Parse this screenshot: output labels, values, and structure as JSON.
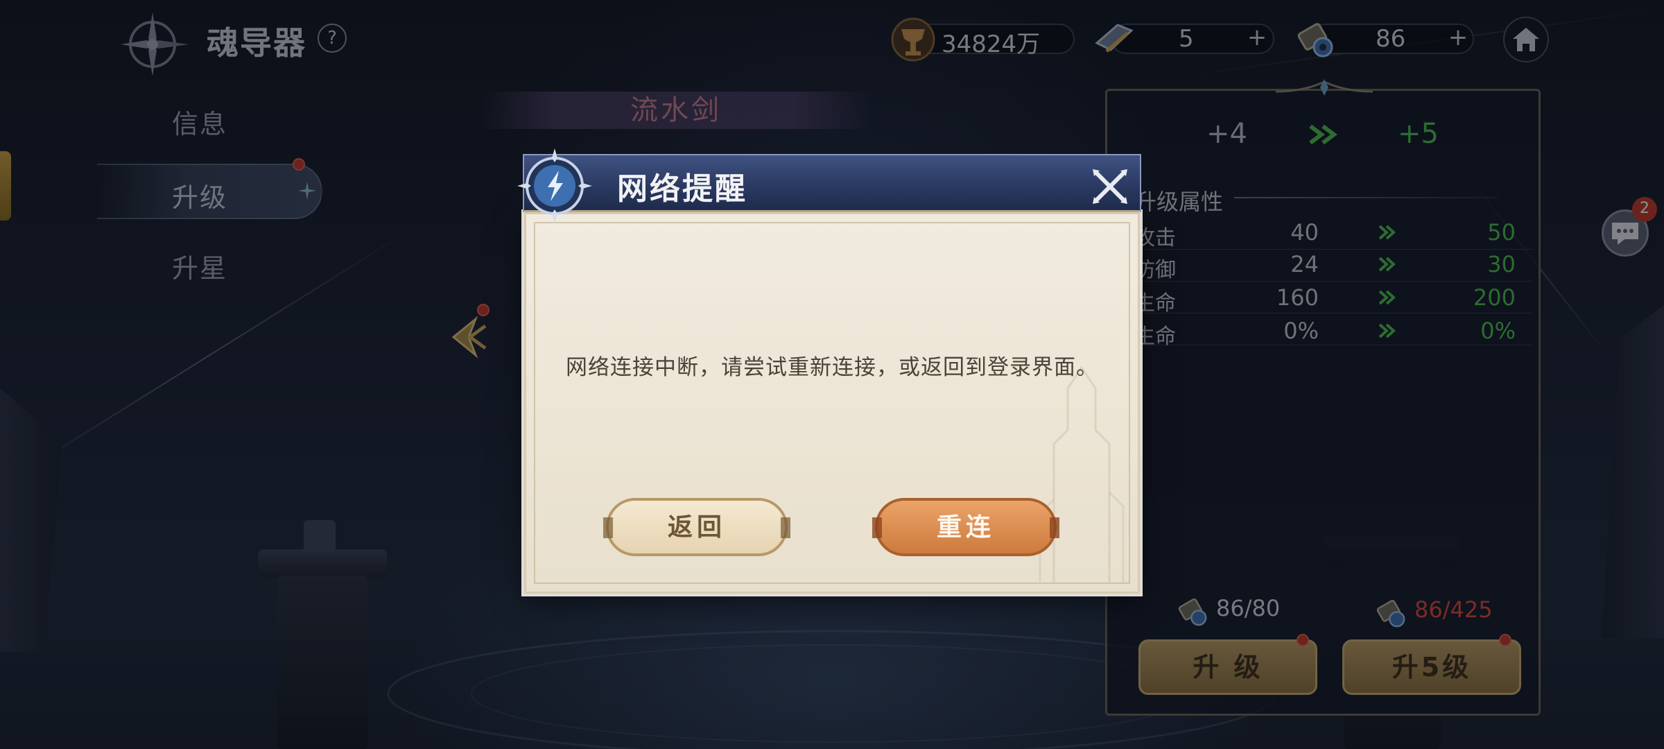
{
  "page": {
    "title": "魂导器",
    "help": "?"
  },
  "resources": {
    "gold": {
      "value": "34824万",
      "icon": "gold-trophy-icon"
    },
    "stamina": {
      "value": "5",
      "icon": "scroll-ticket-icon",
      "plus": "+"
    },
    "material": {
      "value": "86",
      "icon": "gear-material-icon",
      "plus": "+"
    },
    "home_icon": "home-icon"
  },
  "nav": {
    "items": [
      {
        "label": "信息"
      },
      {
        "label": "升级",
        "active": true,
        "badge": true
      },
      {
        "label": "升星"
      }
    ]
  },
  "weapon": {
    "name": "流水剑"
  },
  "upgrade_panel": {
    "level_from": "+4",
    "level_to": "+5",
    "section_title": "升级属性",
    "stats": [
      {
        "name": "攻击",
        "old": "40",
        "new": "50"
      },
      {
        "name": "防御",
        "old": "24",
        "new": "30"
      },
      {
        "name": "生命",
        "old": "160",
        "new": "200"
      },
      {
        "name": "生命",
        "old": "0%",
        "new": "0%"
      }
    ],
    "cost_single": "86/80",
    "cost_multi": "86/425",
    "btn_upgrade": "升 级",
    "btn_upgrade5": "升5级"
  },
  "chat": {
    "badge": "2"
  },
  "dialog": {
    "title": "网络提醒",
    "message": "网络连接中断，请尝试重新连接，或返回到登录界面。",
    "btn_back": "返回",
    "btn_reconnect": "重连"
  },
  "colors": {
    "green": "#4bbd4f",
    "red": "#d9493b",
    "gold_button": "#b79a62",
    "reconnect_orange": "#db8a4e",
    "dialog_header": "#2b3a62",
    "dialog_body": "#efe8da"
  }
}
